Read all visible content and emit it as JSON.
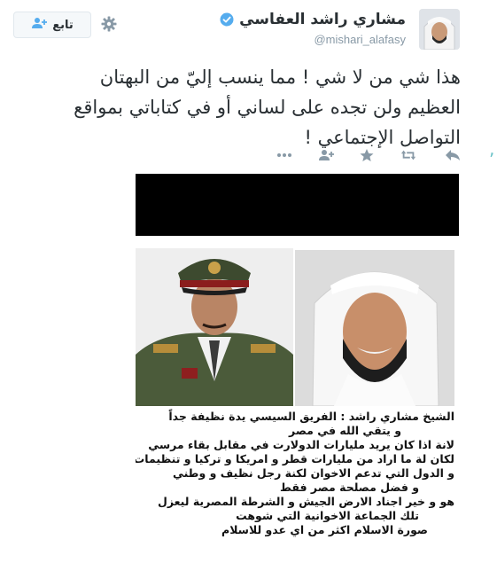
{
  "profile": {
    "display_name": "مشاري راشد العفاسي",
    "handle": "@mishari_alafasy",
    "follow_label": "تابع"
  },
  "icons": {
    "avatar": "profile-photo",
    "verified": "verified-badge-icon",
    "settings": "gear-icon",
    "follow": "add-user-icon",
    "reply": "reply-icon",
    "retweet": "retweet-icon",
    "favorite": "star-icon",
    "follow_small": "add-user-icon",
    "more": "more-dots-icon"
  },
  "colors": {
    "verified_blue": "#55acee",
    "muted": "#8899a6",
    "text": "#292f33"
  },
  "tweet": {
    "text": "هذا شي من لا شي ! مما ينسب إليّ من البهتان العظيم ولن تجده على لساني أو في كتاباتي بمواقع التواصل الإجتماعي !"
  },
  "media": {
    "caption_lines": [
      "الشيخ مشاري راشد : الفريق السيسي يدة نظيفة جداً",
      "و يتقي الله في مصر",
      "لانة اذا كان يريد مليارات الدولارت في مقابل بقاء مرسي",
      "لكان لة ما اراد من مليارات قطر و امريكا و تركيا و تنظيمات",
      "و الدول التي تدعم الاخوان لكنة رجل نظيف و وطني",
      "و فضل مصلحة مصر فقط",
      "هو و خير اجناد الارض الجيش و الشرطة المصرية ليعزل",
      "تلك الجماعة الاخوانية التي شوهت",
      "صورة الاسلام اكثر من اي عدو للاسلام"
    ]
  }
}
